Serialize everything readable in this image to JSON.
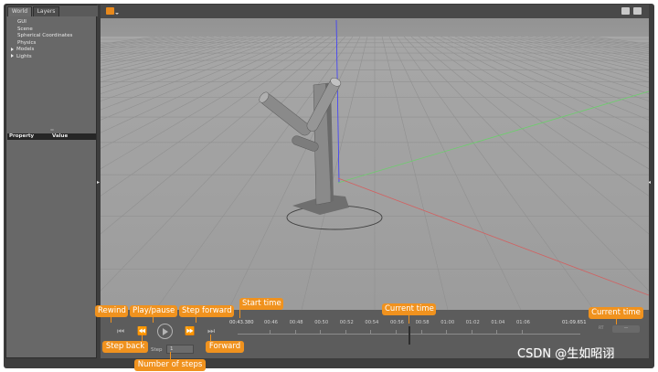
{
  "left_panel": {
    "tabs": [
      "World",
      "Layers"
    ],
    "tree": [
      {
        "label": "GUI",
        "expandable": false
      },
      {
        "label": "Scene",
        "expandable": false
      },
      {
        "label": "Spherical Coordinates",
        "expandable": false
      },
      {
        "label": "Physics",
        "expandable": false
      },
      {
        "label": "Models",
        "expandable": true
      },
      {
        "label": "Lights",
        "expandable": true
      }
    ],
    "property_header": {
      "property": "Property",
      "value": "Value"
    }
  },
  "toolbar": {
    "left_icon": "folder-orange-icon",
    "right_icons": [
      "screenshot-icon",
      "record-icon"
    ]
  },
  "scene": {
    "background_color": "#8f8f8f",
    "ground_color": "#a3a3a3",
    "axis_colors": {
      "z": "#3a3aff",
      "y": "#64c864",
      "x": "#c85050"
    }
  },
  "playback": {
    "rewind_icon": "rewind-icon",
    "step_back_icon": "step-back-icon",
    "play_icon": "play-icon",
    "step_forward_icon": "step-forward-icon",
    "forward_icon": "forward-icon",
    "step_label": "Step",
    "step_value": "1",
    "start_time": "00:43.380",
    "ticks": [
      "00:46",
      "00:48",
      "00:50",
      "00:52",
      "00:54",
      "00:56",
      "00:58",
      "01:00",
      "01:02",
      "01:04",
      "01:06"
    ],
    "current_time": "01:09.651"
  },
  "callouts": {
    "rewind": "Rewind",
    "play_pause": "Play/pause",
    "step_forward": "Step forward",
    "start_time": "Start time",
    "current_time_center": "Current time",
    "current_time_right": "Current time",
    "step_back": "Step back",
    "forward": "Forward",
    "number_of_steps": "Number of steps"
  },
  "watermark": "CSDN @生如昭诩",
  "colors": {
    "callout": "#f0921e",
    "window": "#3d3d3d"
  }
}
